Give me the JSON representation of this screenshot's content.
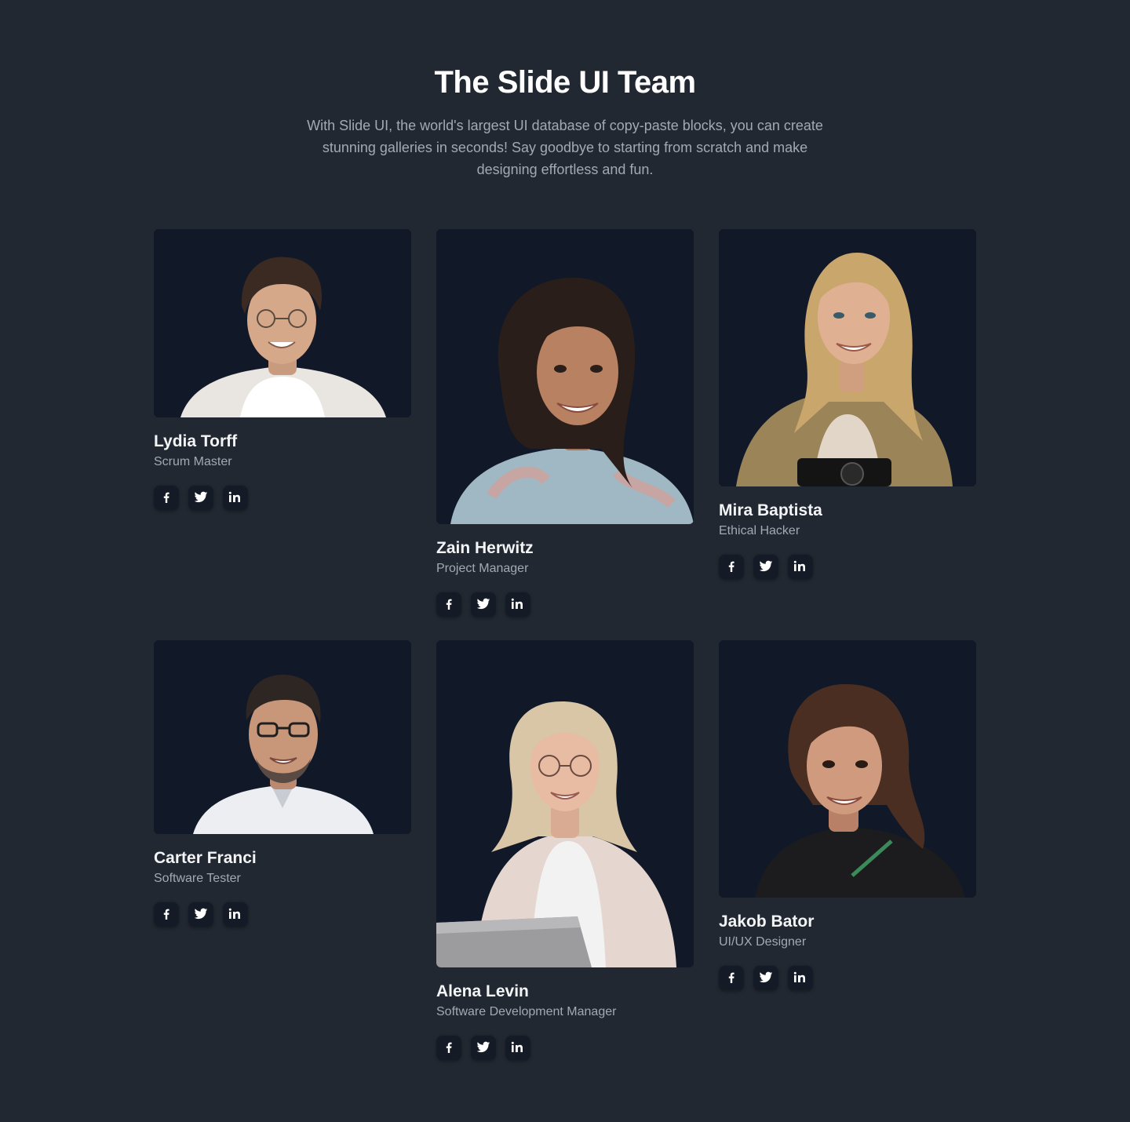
{
  "header": {
    "title": "The Slide UI Team",
    "subtitle": "With Slide UI, the world's largest UI database of copy-paste blocks, you can create stunning galleries in seconds! Say goodbye to starting from scratch and make designing effortless and fun."
  },
  "social_icons": [
    "facebook-icon",
    "twitter-icon",
    "linkedin-icon"
  ],
  "colors": {
    "background": "#222831",
    "card_photo_bg": "#111827",
    "text_primary": "#f3f4f6",
    "text_secondary": "#a3a9b3"
  },
  "team": [
    {
      "name": "Lydia Torff",
      "role": "Scrum Master"
    },
    {
      "name": "Zain Herwitz",
      "role": "Project Manager"
    },
    {
      "name": "Mira Baptista",
      "role": "Ethical Hacker"
    },
    {
      "name": "Carter Franci",
      "role": "Software Tester"
    },
    {
      "name": "Alena Levin",
      "role": "Software Development Manager"
    },
    {
      "name": "Jakob Bator",
      "role": "UI/UX Designer"
    }
  ]
}
